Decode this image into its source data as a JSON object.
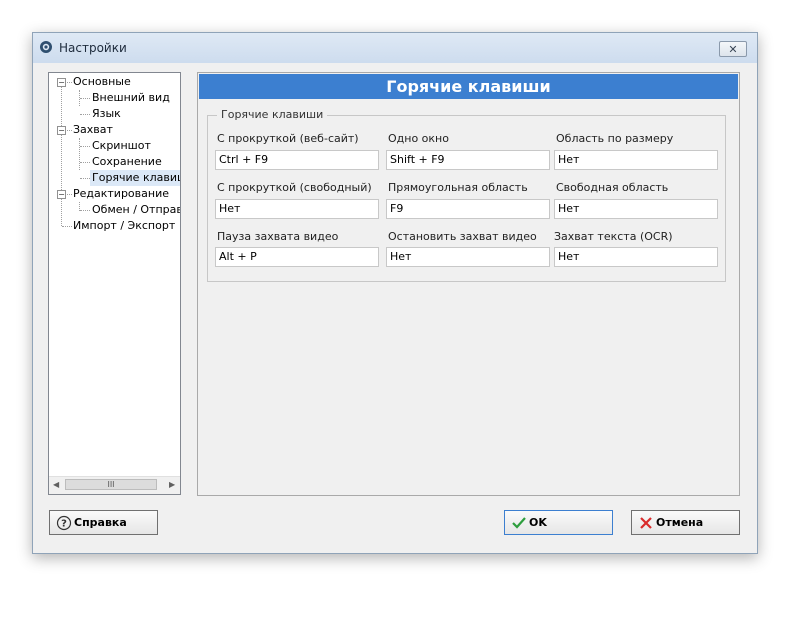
{
  "window": {
    "title": "Настройки"
  },
  "tree": {
    "items": [
      {
        "label": "Основные",
        "level": 0,
        "expanded": true
      },
      {
        "label": "Внешний вид",
        "level": 1
      },
      {
        "label": "Язык",
        "level": 1
      },
      {
        "label": "Захват",
        "level": 0,
        "expanded": true
      },
      {
        "label": "Скриншот",
        "level": 1
      },
      {
        "label": "Сохранение",
        "level": 1
      },
      {
        "label": "Горячие клавиши",
        "level": 1,
        "selected": true
      },
      {
        "label": "Редактирование",
        "level": 0,
        "expanded": true
      },
      {
        "label": "Обмен / Отправка",
        "level": 1
      },
      {
        "label": "Импорт / Экспорт",
        "level": 0
      }
    ],
    "scroll_thumb": "III"
  },
  "panel": {
    "header": "Горячие клавиши",
    "group_title": "Горячие клавиши",
    "hotkeys": [
      {
        "label": "С прокруткой (веб-сайт)",
        "value": "Ctrl + F9"
      },
      {
        "label": "Одно окно",
        "value": "Shift + F9"
      },
      {
        "label": "Область по размеру",
        "value": "Нет"
      },
      {
        "label": "С прокруткой (свободный)",
        "value": "Нет"
      },
      {
        "label": "Прямоугольная область",
        "value": "F9"
      },
      {
        "label": "Свободная область",
        "value": "Нет"
      },
      {
        "label": "Пауза захвата видео",
        "value": "Alt + P"
      },
      {
        "label": "Остановить захват видео",
        "value": "Нет"
      },
      {
        "label": "Захват текста (OCR)",
        "value": "Нет"
      }
    ]
  },
  "buttons": {
    "help": "Справка",
    "ok": "OK",
    "cancel": "Отмена"
  },
  "colors": {
    "accent": "#3c7fd0",
    "ok_check": "#2e9e3e",
    "cancel_x": "#d92b2b"
  }
}
